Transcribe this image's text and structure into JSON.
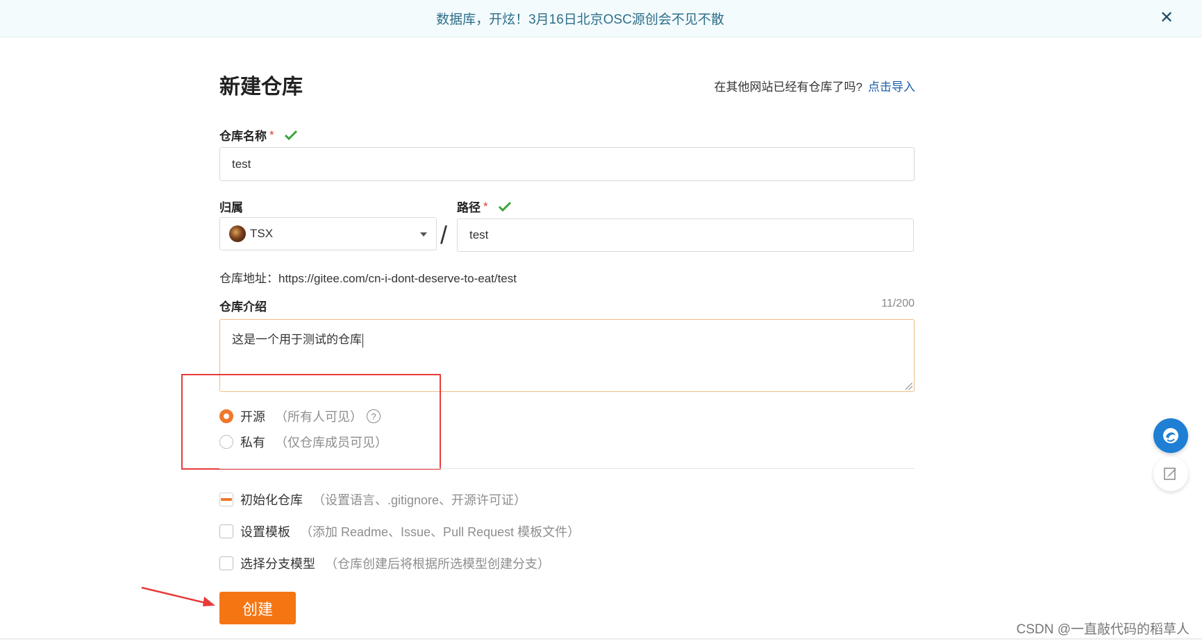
{
  "banner": {
    "text": "数据库，开炫！3月16日北京OSC源创会不见不散",
    "close": "✕"
  },
  "header": {
    "title": "新建仓库",
    "import_prompt": "在其他网站已经有仓库了吗?",
    "import_link": "点击导入"
  },
  "repo_name": {
    "label": "仓库名称",
    "required": "*",
    "value": "test"
  },
  "owner": {
    "label": "归属",
    "value": "TSX"
  },
  "path": {
    "label": "路径",
    "required": "*",
    "separator": "/",
    "value": "test"
  },
  "repo_address": "仓库地址：https://gitee.com/cn-i-dont-deserve-to-eat/test",
  "description": {
    "label": "仓库介绍",
    "counter": "11/200",
    "value": "这是一个用于测试的仓库"
  },
  "visibility": {
    "options": [
      {
        "label": "开源",
        "hint": "（所有人可见）",
        "selected": true
      },
      {
        "label": "私有",
        "hint": "（仅仓库成员可见）",
        "selected": false
      }
    ],
    "help": "?"
  },
  "options": [
    {
      "label": "初始化仓库",
      "hint": "（设置语言、.gitignore、开源许可证）",
      "checked": true
    },
    {
      "label": "设置模板",
      "hint": "（添加 Readme、Issue、Pull Request 模板文件）",
      "checked": false
    },
    {
      "label": "选择分支模型",
      "hint": "（仓库创建后将根据所选模型创建分支）",
      "checked": false
    }
  ],
  "create_button": "创建",
  "watermark": "CSDN @一直敲代码的稻草人",
  "colors": {
    "accent": "#f57513",
    "annotation": "#e83a3a",
    "link": "#1a5fa8",
    "success": "#3aa33a"
  },
  "icons": [
    "close-icon",
    "check-icon",
    "caret-down-icon",
    "help-icon",
    "assistant-icon",
    "feedback-icon",
    "arrow-annotation-icon"
  ]
}
